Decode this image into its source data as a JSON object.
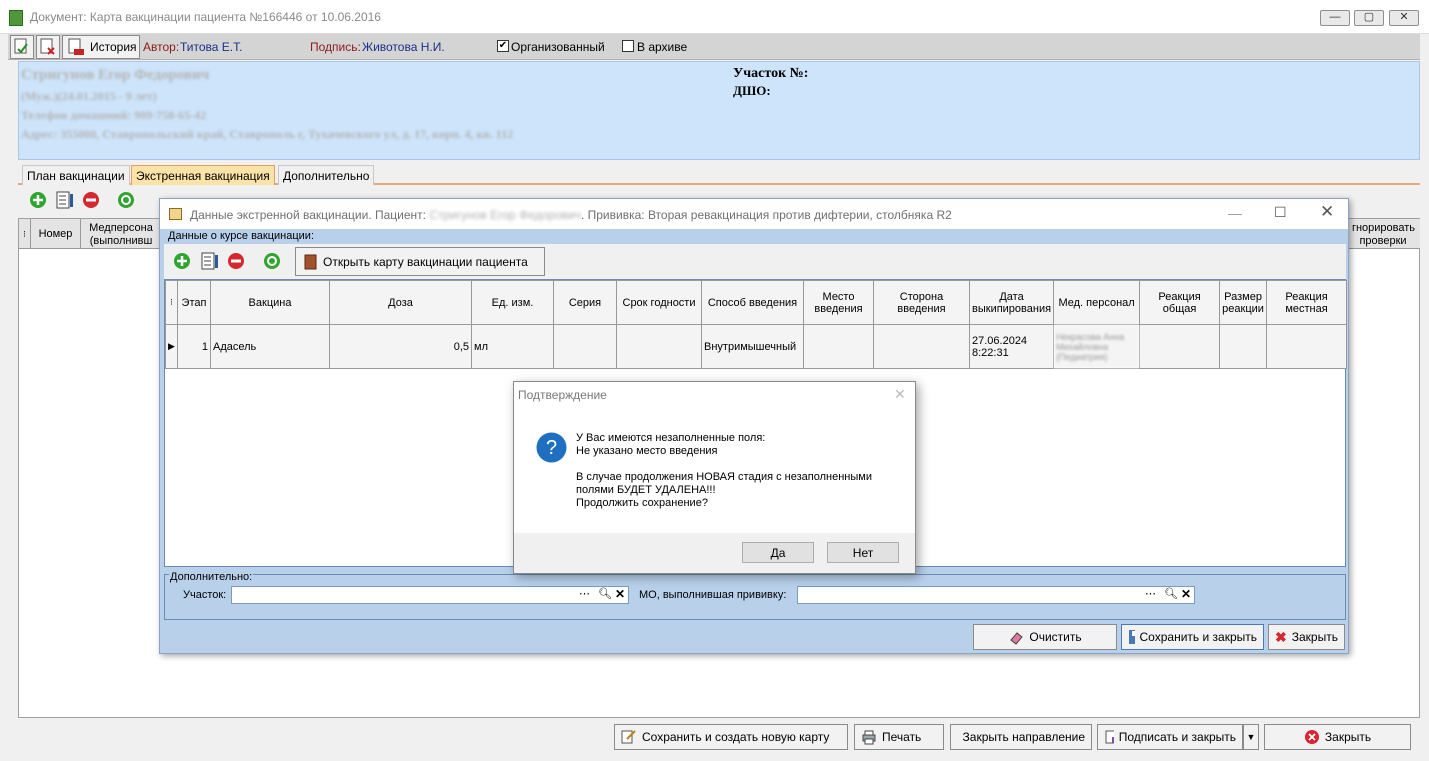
{
  "window": {
    "title": "Документ: Карта вакцинации пациента №166446 от 10.06.2016"
  },
  "toolbar": {
    "history_label": "История",
    "author_label": "Автор:",
    "author_value": "Титова Е.Т.",
    "signature_label": "Подпись:",
    "signature_value": "Животова Н.И.",
    "organized_label": "Организованный",
    "organized_checked": true,
    "archive_label": "В архиве",
    "archive_checked": false
  },
  "patient": {
    "name": "Стригунов Егор Федорович",
    "line2": "(Муж.)(24.01.2015 - 9 лет)",
    "phone": "Телефон домашний: 909-758-65-42",
    "address": "Адрес: 355000, Ставропольский край, Ставрополь г, Тухачевского ул, д. 17, корп. 4, кв. 112",
    "district_label": "Участок №:",
    "dshu_label": "ДШО:"
  },
  "tabs": [
    "План вакцинации",
    "Экстренная вакцинация",
    "Дополнительно"
  ],
  "active_tab": 1,
  "main_grid": {
    "col_number": "Номер",
    "col_staff_line1": "Медперсона",
    "col_staff_line2": "(выполнивш",
    "col_ignore_line1": "гнорировать",
    "col_ignore_line2": "проверки"
  },
  "child": {
    "title_prefix": "Данные экстренной вакцинации. Пациент:",
    "title_patient": "Стригунов Егор Федорович",
    "title_suffix": ". Прививка: Вторая ревакцинация против дифтерии, столбняка R2",
    "course_group": "Данные о курсе вакцинации:",
    "open_card_button": "Открыть карту вакцинации пациента",
    "columns": [
      "Этап",
      "Вакцина",
      "Доза",
      "Ед. изм.",
      "Серия",
      "Срок годности",
      "Способ введения",
      "Место введения",
      "Сторона введения",
      "Дата выкипирования",
      "Мед. персонал",
      "Реакция общая",
      "Размер реакции",
      "Реакция местная"
    ],
    "row": {
      "stage": "1",
      "vaccine": "Адасель",
      "dose": "0,5",
      "unit": "мл",
      "series": "",
      "expiry": "",
      "method": "Внутримышечный",
      "place": "",
      "side": "",
      "date_line1": "27.06.2024",
      "date_line2": "8:22:31",
      "staff": "Некрасова Анна Михайловна (Педиатрия)"
    },
    "extra_group": "Дополнительно:",
    "district_label": "Участок:",
    "mo_label": "МО, выполнившая прививку:",
    "clear_button": "Очистить",
    "save_close_button": "Сохранить и закрыть",
    "close_button": "Закрыть"
  },
  "dialog": {
    "title": "Подтверждение",
    "line1": "У Вас имеются незаполненные поля:",
    "line2": "Не указано место введения",
    "line3": "В случае продолжения НОВАЯ стадия с незаполненными",
    "line4": "полями БУДЕТ УДАЛЕНА!!!",
    "line5": "Продолжить сохранение?",
    "yes": "Да",
    "no": "Нет"
  },
  "bottom": {
    "save_new": "Сохранить и создать новую карту",
    "print": "Печать",
    "close_referral": "Закрыть направление",
    "sign_close": "Подписать и закрыть",
    "close": "Закрыть"
  },
  "colors": {
    "header_bg": "#cde4fb",
    "child_bg": "#b8d0ea",
    "active_tab": "#fbe3a8",
    "add_green": "#2fa52f",
    "delete_red": "#d6272e"
  }
}
